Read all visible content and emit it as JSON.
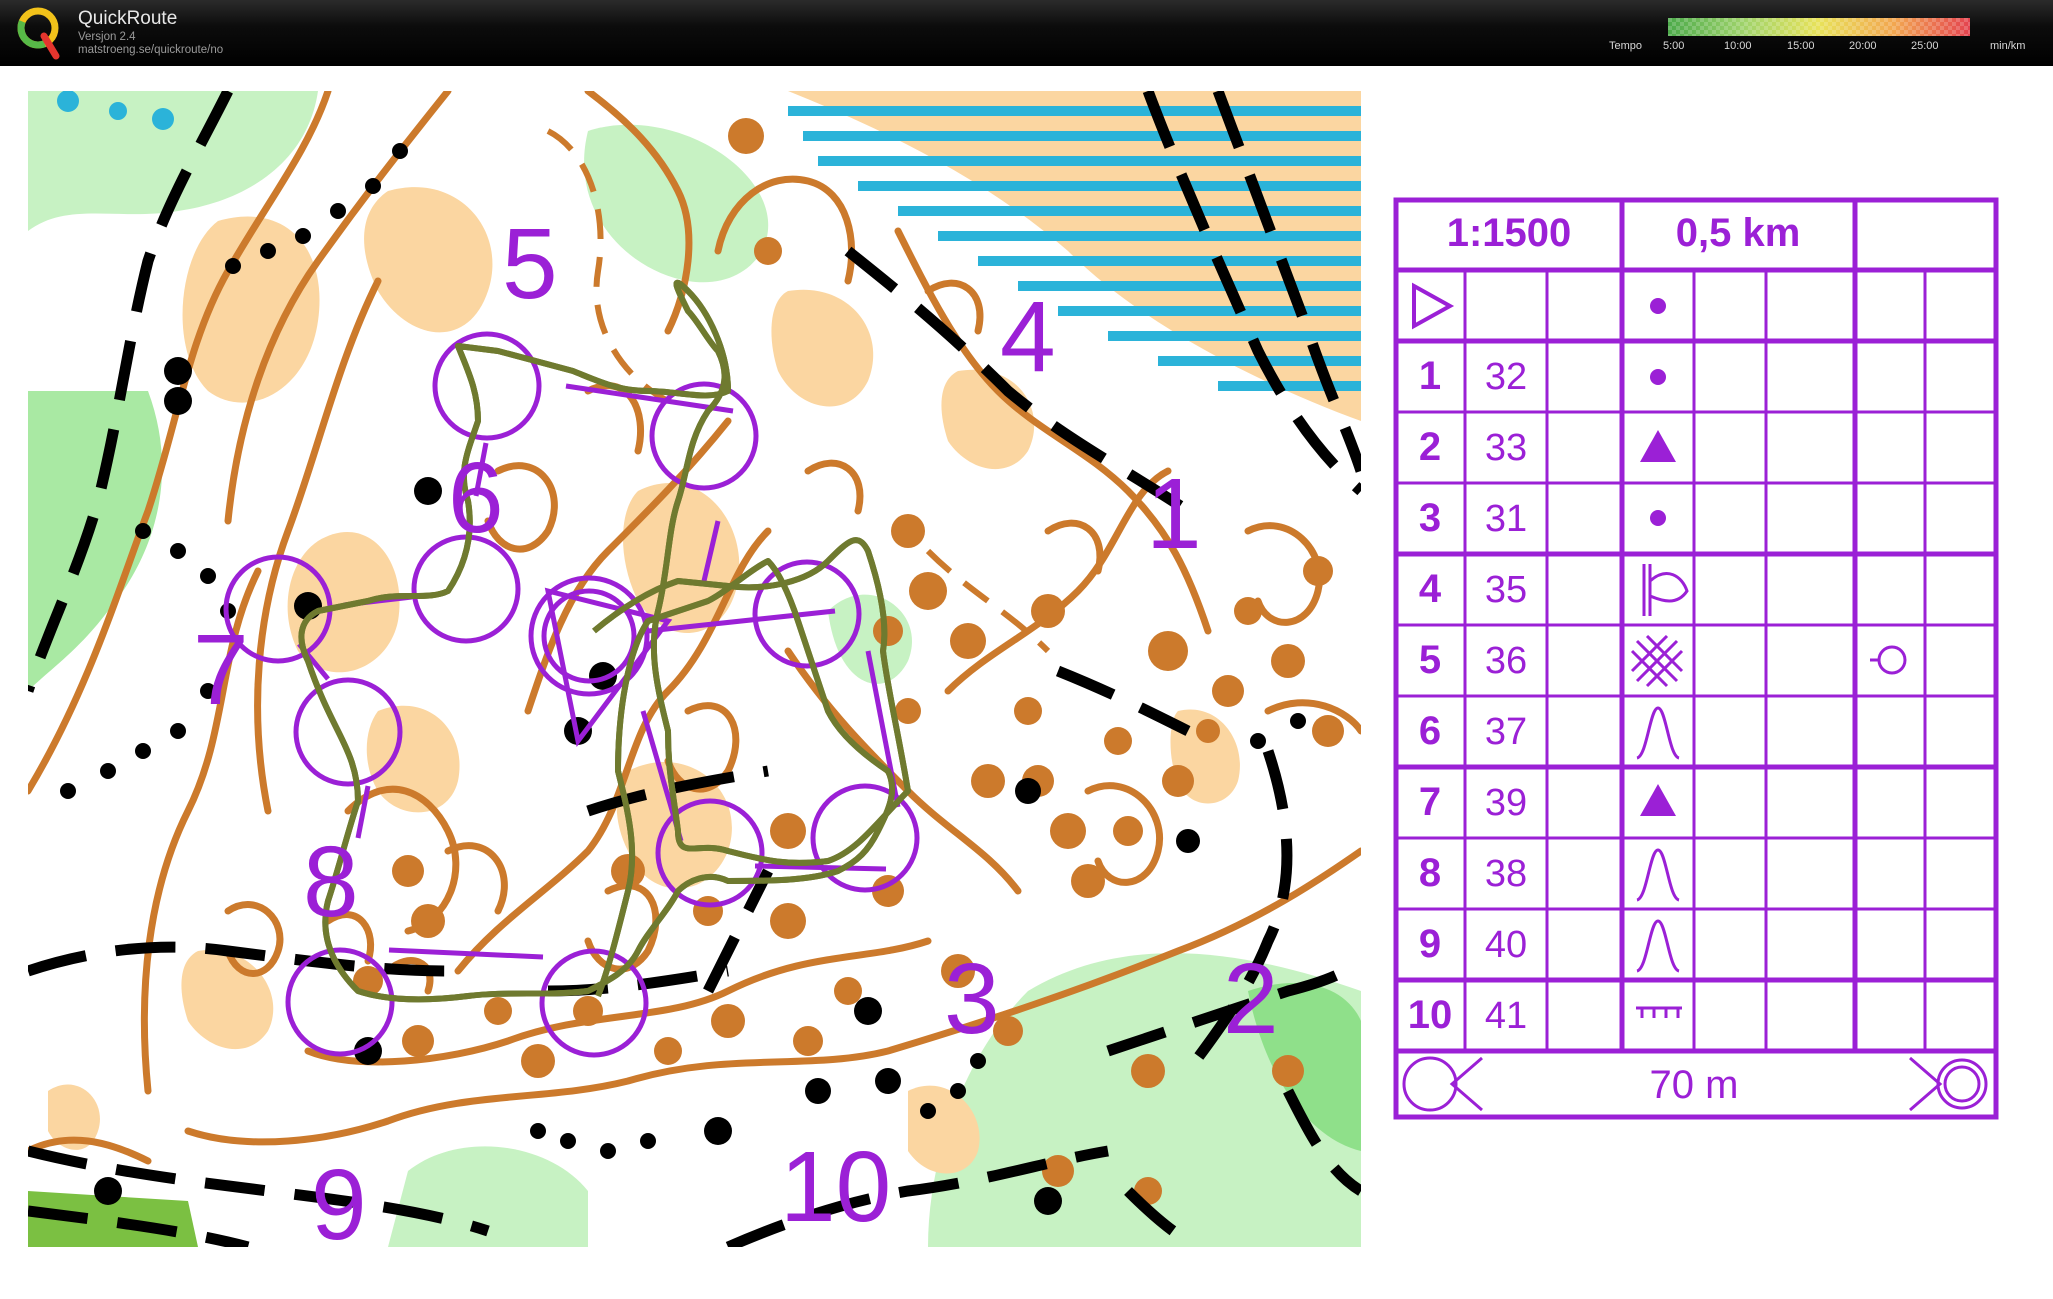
{
  "app": {
    "title": "QuickRoute",
    "version": "Versjon 2.4",
    "url": "matstroeng.se/quickroute/no"
  },
  "pace_scale": {
    "label": "Tempo",
    "unit": "min/km",
    "ticks": [
      "5:00",
      "10:00",
      "15:00",
      "20:00",
      "25:00"
    ]
  },
  "map": {
    "control_numbers": [
      "1",
      "2",
      "3",
      "4",
      "5",
      "6",
      "7",
      "8",
      "9",
      "10"
    ]
  },
  "description_sheet": {
    "scale": "1:1500",
    "length": "0,5 km",
    "finish_distance": "70 m",
    "rows": [
      {
        "num": "1",
        "code": "32",
        "symbol": "dot-icon"
      },
      {
        "num": "2",
        "code": "33",
        "symbol": "triangle-icon"
      },
      {
        "num": "3",
        "code": "31",
        "symbol": "dot-icon"
      },
      {
        "num": "4",
        "code": "35",
        "symbol": "reentrant-icon"
      },
      {
        "num": "5",
        "code": "36",
        "symbol": "thicket-icon"
      },
      {
        "num": "6",
        "code": "37",
        "symbol": "knoll-icon"
      },
      {
        "num": "7",
        "code": "39",
        "symbol": "triangle-icon"
      },
      {
        "num": "8",
        "code": "38",
        "symbol": "knoll-icon"
      },
      {
        "num": "9",
        "code": "40",
        "symbol": "knoll-icon"
      },
      {
        "num": "10",
        "code": "41",
        "symbol": "wall-icon"
      }
    ]
  },
  "colors": {
    "course": "#9b20d6",
    "contour": "#cc7a2c",
    "open_land": "#fbd6a1",
    "forest_green": "#c7f2c3",
    "green_dark": "#8fe08a",
    "water": "#2bb3d9"
  }
}
